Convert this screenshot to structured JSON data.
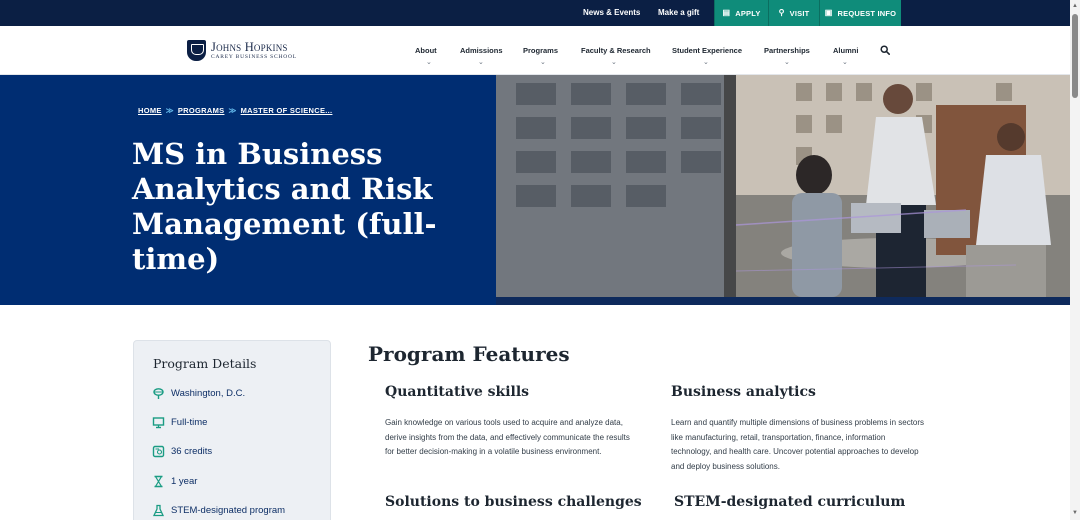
{
  "utility_bar": {
    "news_events": "News & Events",
    "make_gift": "Make a gift",
    "apply": "APPLY",
    "visit": "VISIT",
    "request_info": "REQUEST INFO"
  },
  "logo": {
    "name": "Johns Hopkins",
    "subtitle": "CAREY BUSINESS SCHOOL"
  },
  "nav": {
    "items": [
      "About",
      "Admissions",
      "Programs",
      "Faculty & Research",
      "Student Experience",
      "Partnerships",
      "Alumni"
    ],
    "chevron": "⌄"
  },
  "breadcrumb": {
    "items": [
      "HOME",
      "PROGRAMS",
      "MASTER OF SCIENCE..."
    ],
    "separator": "≫"
  },
  "hero": {
    "title": "MS in Business Analytics and Risk Management (full-time)"
  },
  "program_details": {
    "title": "Program Details",
    "items": [
      {
        "icon": "location-pin-icon",
        "label": "Washington, D.C."
      },
      {
        "icon": "monitor-icon",
        "label": "Full-time"
      },
      {
        "icon": "certificate-icon",
        "label": "36 credits"
      },
      {
        "icon": "hourglass-icon",
        "label": "1 year"
      },
      {
        "icon": "flask-icon",
        "label": "STEM-designated program"
      }
    ]
  },
  "features": {
    "title": "Program Features",
    "items": [
      {
        "heading": "Quantitative skills",
        "body": "Gain knowledge on various tools used to acquire and analyze data, derive insights from the data, and effectively communicate the results for better decision-making in a volatile business environment."
      },
      {
        "heading": "Business analytics",
        "body": "Learn and quantify multiple dimensions of business problems in sectors like manufacturing, retail, transportation, finance, information technology, and health care. Uncover potential approaches to develop and deploy business solutions."
      },
      {
        "heading": "Solutions to business challenges",
        "body": ""
      },
      {
        "heading": "STEM-designated curriculum",
        "body": ""
      }
    ]
  },
  "colors": {
    "navy": "#002d72",
    "dark_navy": "#0b1f44",
    "teal_cta": "#0f8c7a",
    "icon_teal": "#1a9c83"
  }
}
